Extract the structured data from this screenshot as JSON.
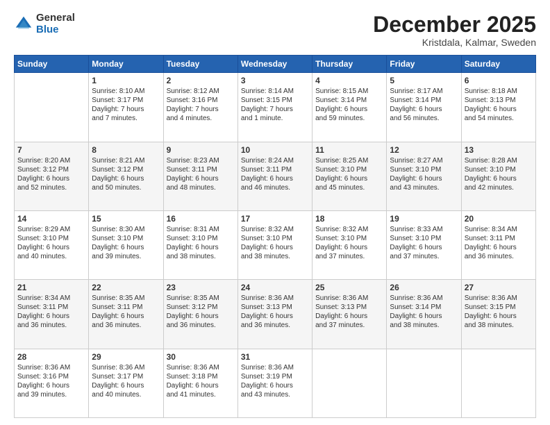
{
  "logo": {
    "general": "General",
    "blue": "Blue"
  },
  "title": {
    "month": "December 2025",
    "location": "Kristdala, Kalmar, Sweden"
  },
  "weekdays": [
    "Sunday",
    "Monday",
    "Tuesday",
    "Wednesday",
    "Thursday",
    "Friday",
    "Saturday"
  ],
  "weeks": [
    [
      {
        "day": "",
        "info": ""
      },
      {
        "day": "1",
        "info": "Sunrise: 8:10 AM\nSunset: 3:17 PM\nDaylight: 7 hours\nand 7 minutes."
      },
      {
        "day": "2",
        "info": "Sunrise: 8:12 AM\nSunset: 3:16 PM\nDaylight: 7 hours\nand 4 minutes."
      },
      {
        "day": "3",
        "info": "Sunrise: 8:14 AM\nSunset: 3:15 PM\nDaylight: 7 hours\nand 1 minute."
      },
      {
        "day": "4",
        "info": "Sunrise: 8:15 AM\nSunset: 3:14 PM\nDaylight: 6 hours\nand 59 minutes."
      },
      {
        "day": "5",
        "info": "Sunrise: 8:17 AM\nSunset: 3:14 PM\nDaylight: 6 hours\nand 56 minutes."
      },
      {
        "day": "6",
        "info": "Sunrise: 8:18 AM\nSunset: 3:13 PM\nDaylight: 6 hours\nand 54 minutes."
      }
    ],
    [
      {
        "day": "7",
        "info": "Sunrise: 8:20 AM\nSunset: 3:12 PM\nDaylight: 6 hours\nand 52 minutes."
      },
      {
        "day": "8",
        "info": "Sunrise: 8:21 AM\nSunset: 3:12 PM\nDaylight: 6 hours\nand 50 minutes."
      },
      {
        "day": "9",
        "info": "Sunrise: 8:23 AM\nSunset: 3:11 PM\nDaylight: 6 hours\nand 48 minutes."
      },
      {
        "day": "10",
        "info": "Sunrise: 8:24 AM\nSunset: 3:11 PM\nDaylight: 6 hours\nand 46 minutes."
      },
      {
        "day": "11",
        "info": "Sunrise: 8:25 AM\nSunset: 3:10 PM\nDaylight: 6 hours\nand 45 minutes."
      },
      {
        "day": "12",
        "info": "Sunrise: 8:27 AM\nSunset: 3:10 PM\nDaylight: 6 hours\nand 43 minutes."
      },
      {
        "day": "13",
        "info": "Sunrise: 8:28 AM\nSunset: 3:10 PM\nDaylight: 6 hours\nand 42 minutes."
      }
    ],
    [
      {
        "day": "14",
        "info": "Sunrise: 8:29 AM\nSunset: 3:10 PM\nDaylight: 6 hours\nand 40 minutes."
      },
      {
        "day": "15",
        "info": "Sunrise: 8:30 AM\nSunset: 3:10 PM\nDaylight: 6 hours\nand 39 minutes."
      },
      {
        "day": "16",
        "info": "Sunrise: 8:31 AM\nSunset: 3:10 PM\nDaylight: 6 hours\nand 38 minutes."
      },
      {
        "day": "17",
        "info": "Sunrise: 8:32 AM\nSunset: 3:10 PM\nDaylight: 6 hours\nand 38 minutes."
      },
      {
        "day": "18",
        "info": "Sunrise: 8:32 AM\nSunset: 3:10 PM\nDaylight: 6 hours\nand 37 minutes."
      },
      {
        "day": "19",
        "info": "Sunrise: 8:33 AM\nSunset: 3:10 PM\nDaylight: 6 hours\nand 37 minutes."
      },
      {
        "day": "20",
        "info": "Sunrise: 8:34 AM\nSunset: 3:11 PM\nDaylight: 6 hours\nand 36 minutes."
      }
    ],
    [
      {
        "day": "21",
        "info": "Sunrise: 8:34 AM\nSunset: 3:11 PM\nDaylight: 6 hours\nand 36 minutes."
      },
      {
        "day": "22",
        "info": "Sunrise: 8:35 AM\nSunset: 3:11 PM\nDaylight: 6 hours\nand 36 minutes."
      },
      {
        "day": "23",
        "info": "Sunrise: 8:35 AM\nSunset: 3:12 PM\nDaylight: 6 hours\nand 36 minutes."
      },
      {
        "day": "24",
        "info": "Sunrise: 8:36 AM\nSunset: 3:13 PM\nDaylight: 6 hours\nand 36 minutes."
      },
      {
        "day": "25",
        "info": "Sunrise: 8:36 AM\nSunset: 3:13 PM\nDaylight: 6 hours\nand 37 minutes."
      },
      {
        "day": "26",
        "info": "Sunrise: 8:36 AM\nSunset: 3:14 PM\nDaylight: 6 hours\nand 38 minutes."
      },
      {
        "day": "27",
        "info": "Sunrise: 8:36 AM\nSunset: 3:15 PM\nDaylight: 6 hours\nand 38 minutes."
      }
    ],
    [
      {
        "day": "28",
        "info": "Sunrise: 8:36 AM\nSunset: 3:16 PM\nDaylight: 6 hours\nand 39 minutes."
      },
      {
        "day": "29",
        "info": "Sunrise: 8:36 AM\nSunset: 3:17 PM\nDaylight: 6 hours\nand 40 minutes."
      },
      {
        "day": "30",
        "info": "Sunrise: 8:36 AM\nSunset: 3:18 PM\nDaylight: 6 hours\nand 41 minutes."
      },
      {
        "day": "31",
        "info": "Sunrise: 8:36 AM\nSunset: 3:19 PM\nDaylight: 6 hours\nand 43 minutes."
      },
      {
        "day": "",
        "info": ""
      },
      {
        "day": "",
        "info": ""
      },
      {
        "day": "",
        "info": ""
      }
    ]
  ]
}
